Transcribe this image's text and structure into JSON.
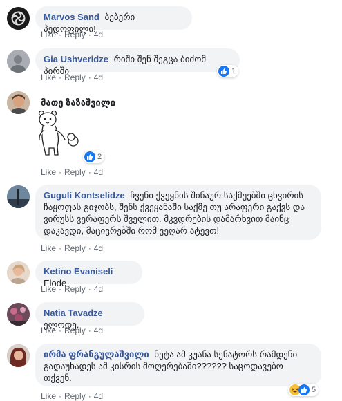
{
  "actions": {
    "like": "Like",
    "reply": "Reply",
    "sep": "·"
  },
  "comments": [
    {
      "author": "Marvos Sand",
      "text": "ბებერი პედოფილი!",
      "time": "4d"
    },
    {
      "author": "Gia Ushveridze",
      "text": "რიში შენ შეგცა ბიძომ პირში",
      "time": "4d",
      "reaction_count": "1"
    },
    {
      "author": "მათე ზაზაშვილი",
      "text": "",
      "time": "4d",
      "reaction_count": "2",
      "sticker": "bear-sticker"
    },
    {
      "author": "Guguli Kontselidze",
      "text": "ჩვენი ქვეყნის შინაურ საქმეებში ცხვირის ჩაყოფას გიჯობს, შენს ქვეყანაში საქმე თუ არაფერი გაქვს და ვირუსს ვერაფერს შველით. მკვდრების დამარხვით მაინც დაკავდი, მაცივრებში რომ ვეღარ ატევთ!",
      "time": "4d"
    },
    {
      "author": "Ketino Evaniseli",
      "text": "Elode",
      "time": "4d"
    },
    {
      "author": "Natia Tavadze",
      "text": "ელოდე.",
      "time": "4d"
    },
    {
      "author": "ირმა ფრანგულაშვილი",
      "text": "ნეტა ამ კუანა სენატორს რამდენი გადაუხადეს ამ კისრის მოღერებაში?????? საცოდავებო თქვენ.",
      "time": "4d",
      "reaction_count": "5"
    }
  ],
  "colors": {
    "author": "#385898",
    "bubble": "#f2f3f5",
    "meta": "#606770",
    "like": "#1877f2"
  }
}
